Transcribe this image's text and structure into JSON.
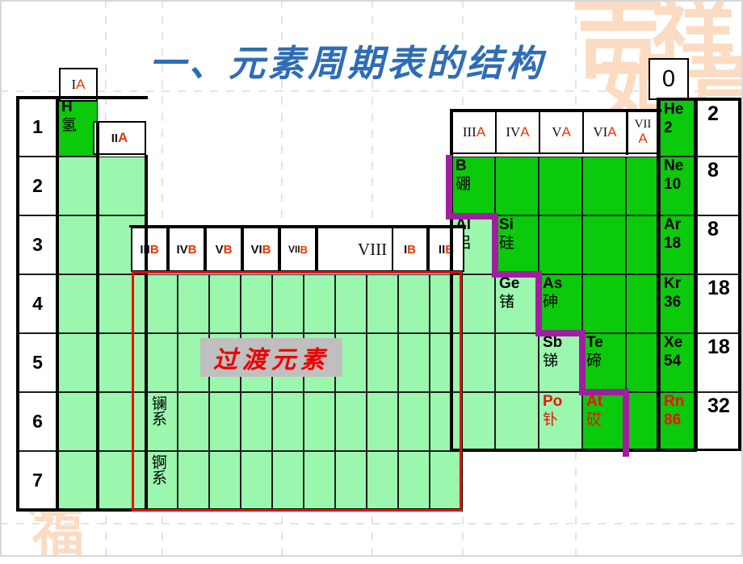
{
  "title": "一、元素周期表的结构",
  "transition_label": "过渡元素",
  "colors": {
    "title_blue": "#2e6db4",
    "dark_green": "#0bc90b",
    "light_green": "#9bf7ae",
    "red_accent": "#ee1111",
    "group_letter_red": "#ee3300",
    "red_box": "#ff0000",
    "stair_purple": "#a11ea1",
    "gray_label_bg": "#bfbfbf",
    "watermark": "#fbdcc2"
  },
  "period_numbers": [
    "1",
    "2",
    "3",
    "4",
    "5",
    "6",
    "7"
  ],
  "electron_counts": [
    "2",
    "8",
    "8",
    "18",
    "18",
    "32"
  ],
  "group_headers_a": [
    {
      "name": "group-IA",
      "roman": "I",
      "letter": "A"
    },
    {
      "name": "group-IIA",
      "roman": "II",
      "letter": "A"
    },
    {
      "name": "group-IIIA",
      "roman": "III",
      "letter": "A"
    },
    {
      "name": "group-IVA",
      "roman": "IV",
      "letter": "A"
    },
    {
      "name": "group-VA",
      "roman": "V",
      "letter": "A"
    },
    {
      "name": "group-VIA",
      "roman": "VI",
      "letter": "A"
    },
    {
      "name": "group-VIIA",
      "roman": "VII",
      "letter": "A"
    },
    {
      "name": "group-0",
      "roman": "0",
      "letter": ""
    }
  ],
  "group_headers_b": [
    {
      "name": "group-IIIB",
      "roman": "III",
      "letter": "B"
    },
    {
      "name": "group-IVB",
      "roman": "IV",
      "letter": "B"
    },
    {
      "name": "group-VB",
      "roman": "V",
      "letter": "B"
    },
    {
      "name": "group-VIB",
      "roman": "VI",
      "letter": "B"
    },
    {
      "name": "group-VIIB",
      "roman": "VII",
      "letter": "B"
    },
    {
      "name": "group-VIII",
      "roman": "VIII",
      "letter": ""
    },
    {
      "name": "group-IB",
      "roman": "I",
      "letter": "B"
    },
    {
      "name": "group-IIB",
      "roman": "II",
      "letter": "B"
    }
  ],
  "elements": {
    "H": {
      "symbol": "H",
      "chinese": "氢",
      "number": ""
    },
    "He": {
      "symbol": "He",
      "chinese": "",
      "number": "2"
    },
    "B": {
      "symbol": "B",
      "chinese": "硼",
      "number": ""
    },
    "Ne": {
      "symbol": "Ne",
      "chinese": "",
      "number": "10"
    },
    "Al": {
      "symbol": "Al",
      "chinese": "铝",
      "number": ""
    },
    "Si": {
      "symbol": "Si",
      "chinese": "硅",
      "number": ""
    },
    "Ar": {
      "symbol": "Ar",
      "chinese": "",
      "number": "18"
    },
    "Ge": {
      "symbol": "Ge",
      "chinese": "锗",
      "number": ""
    },
    "As": {
      "symbol": "As",
      "chinese": "砷",
      "number": ""
    },
    "Kr": {
      "symbol": "Kr",
      "chinese": "",
      "number": "36"
    },
    "Sb": {
      "symbol": "Sb",
      "chinese": "锑",
      "number": ""
    },
    "Te": {
      "symbol": "Te",
      "chinese": "碲",
      "number": ""
    },
    "Xe": {
      "symbol": "Xe",
      "chinese": "",
      "number": "54"
    },
    "Po": {
      "symbol": "Po",
      "chinese": "钋",
      "number": ""
    },
    "At": {
      "symbol": "At",
      "chinese": "砹",
      "number": ""
    },
    "Rn": {
      "symbol": "Rn",
      "chinese": "",
      "number": "86"
    }
  },
  "series_labels": {
    "lanthanide": "镧系",
    "actinide": "锕系"
  },
  "watermark_glyphs": [
    "吉",
    "祥",
    "如",
    "意",
    "喜",
    "福"
  ]
}
